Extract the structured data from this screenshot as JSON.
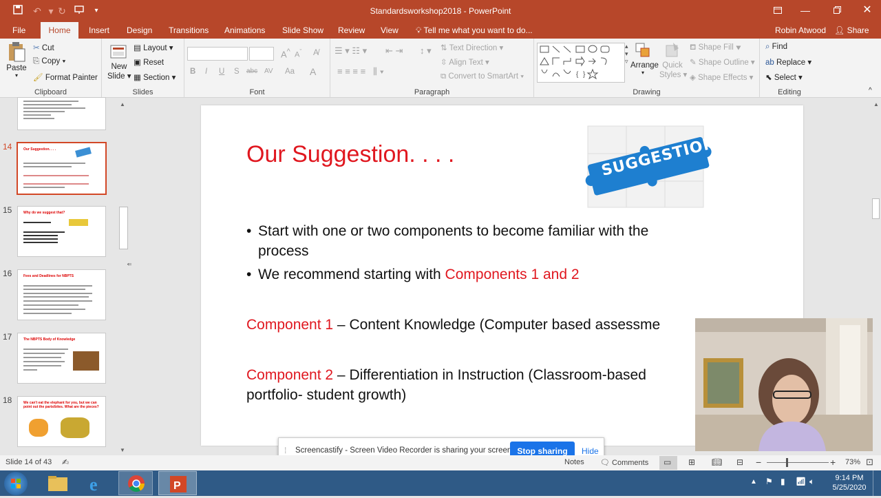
{
  "window": {
    "title": "Standardsworkshop2018 - PowerPoint",
    "user": "Robin Atwood",
    "share": "Share"
  },
  "tabs": [
    "File",
    "Home",
    "Insert",
    "Design",
    "Transitions",
    "Animations",
    "Slide Show",
    "Review",
    "View"
  ],
  "tell_me": "Tell me what you want to do...",
  "clipboard": {
    "paste": "Paste",
    "cut": "Cut",
    "copy": "Copy",
    "format_painter": "Format Painter",
    "label": "Clipboard"
  },
  "slides_group": {
    "new_slide_1": "New",
    "new_slide_2": "Slide",
    "layout": "Layout",
    "reset": "Reset",
    "section": "Section",
    "label": "Slides"
  },
  "font_group": {
    "label": "Font",
    "bold": "B",
    "italic": "I",
    "underline": "U",
    "shadow": "S",
    "strike": "abc",
    "spacing": "AV",
    "case": "Aa"
  },
  "paragraph_group": {
    "label": "Paragraph",
    "text_direction": "Text Direction",
    "align_text": "Align Text",
    "smartart": "Convert to SmartArt"
  },
  "drawing_group": {
    "label": "Drawing",
    "arrange": "Arrange",
    "quick_styles_1": "Quick",
    "quick_styles_2": "Styles",
    "shape_fill": "Shape Fill",
    "shape_outline": "Shape Outline",
    "shape_effects": "Shape Effects"
  },
  "editing_group": {
    "label": "Editing",
    "find": "Find",
    "replace": "Replace",
    "select": "Select"
  },
  "thumbnails": [
    {
      "num": "14",
      "title": "Our Suggestion. . . ."
    },
    {
      "num": "15",
      "title": "Why do we suggest that?"
    },
    {
      "num": "16",
      "title": "Fees and Deadlines for NBPTS"
    },
    {
      "num": "17",
      "title": "The NBPTS Body of Knowledge"
    },
    {
      "num": "18",
      "title": "We can't eat the elephant for you, but we can point out the parts/bites. What are the pieces?"
    }
  ],
  "slide": {
    "title": "Our Suggestion. . . .",
    "badge": "SUGGESTION",
    "bullet1": "Start with one or two components to become familiar with the",
    "bullet1b": "process",
    "bullet2_prefix": "We recommend starting with ",
    "bullet2_highlight": "Components 1 and 2",
    "comp1_label": "Component 1",
    "comp1_text": " – Content Knowledge (Computer based assessme",
    "comp2_label": "Component 2",
    "comp2_text": " – Differentiation in Instruction (Classroom-based",
    "comp2_line2": "portfolio- student growth)"
  },
  "status": {
    "slide_info": "Slide 14 of 43",
    "notes": "Notes",
    "comments": "Comments",
    "zoom": "73%"
  },
  "cast": {
    "message": "Screencastify - Screen Video Recorder is sharing your screen.",
    "stop": "Stop sharing",
    "hide": "Hide"
  },
  "clock": {
    "time": "9:14 PM",
    "date": "5/25/2020"
  },
  "colors": {
    "accent": "#b7472a",
    "slide_red": "#e0171f",
    "cast_blue": "#1a73e8"
  }
}
